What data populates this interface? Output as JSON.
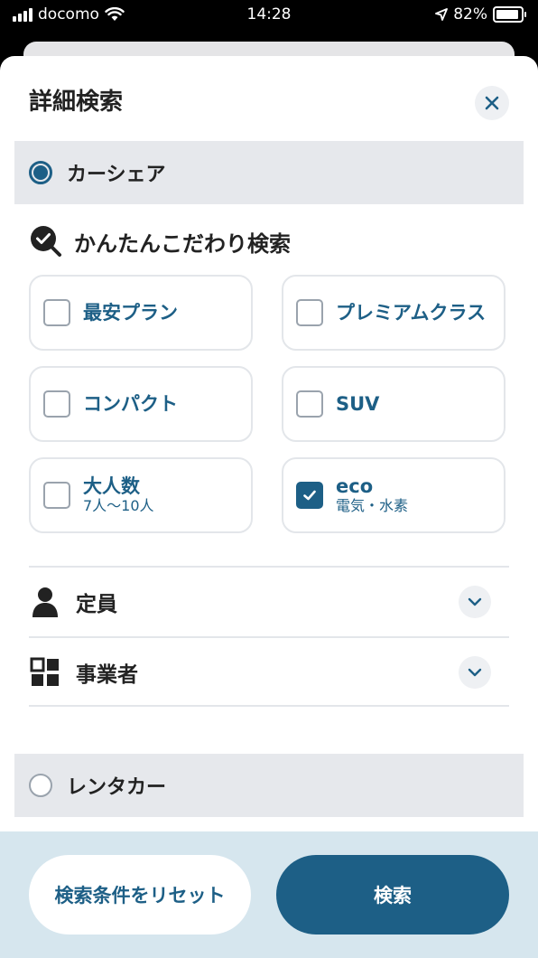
{
  "status_bar": {
    "carrier": "docomo",
    "time": "14:28",
    "battery": "82%"
  },
  "sheet": {
    "title": "詳細検索"
  },
  "options": {
    "carshare": {
      "label": "カーシェア",
      "selected": true
    },
    "rental": {
      "label": "レンタカー",
      "selected": false
    }
  },
  "quick_search": {
    "heading": "かんたんこだわり検索",
    "items": [
      {
        "label": "最安プラン",
        "sub": "",
        "checked": false
      },
      {
        "label": "プレミアムクラス",
        "sub": "",
        "checked": false
      },
      {
        "label": "コンパクト",
        "sub": "",
        "checked": false
      },
      {
        "label": "SUV",
        "sub": "",
        "checked": false
      },
      {
        "label": "大人数",
        "sub": "7人〜10人",
        "checked": false
      },
      {
        "label": "eco",
        "sub": "電気・水素",
        "checked": true
      }
    ]
  },
  "accordions": [
    {
      "label": "定員",
      "icon": "person-icon"
    },
    {
      "label": "事業者",
      "icon": "grid-icon"
    }
  ],
  "buttons": {
    "reset": "検索条件をリセット",
    "search": "検索"
  },
  "colors": {
    "accent": "#1d5f86",
    "option_bg": "#e6e8ec",
    "bottom_bar": "#d6e6ee"
  }
}
